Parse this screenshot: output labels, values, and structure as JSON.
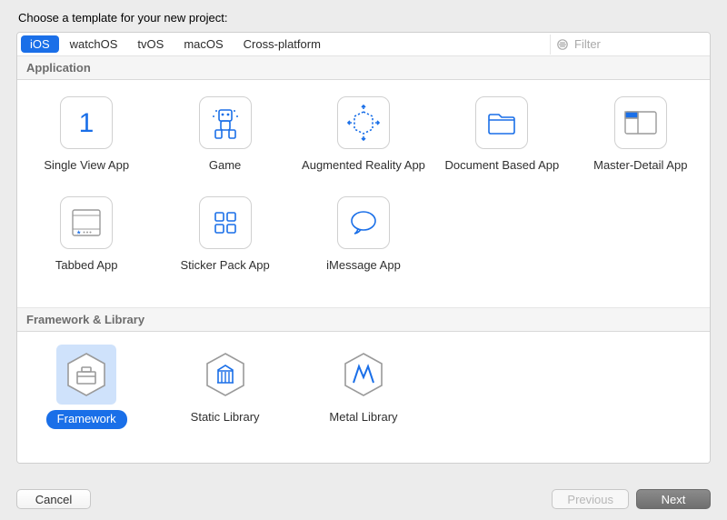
{
  "heading": "Choose a template for your new project:",
  "tabs": [
    "iOS",
    "watchOS",
    "tvOS",
    "macOS",
    "Cross-platform"
  ],
  "selected_tab_index": 0,
  "filter_placeholder": "Filter",
  "sections": {
    "application": {
      "title": "Application",
      "items": [
        {
          "id": "single-view-app",
          "label": "Single View App"
        },
        {
          "id": "game",
          "label": "Game"
        },
        {
          "id": "augmented-reality-app",
          "label": "Augmented Reality App"
        },
        {
          "id": "document-based-app",
          "label": "Document Based App"
        },
        {
          "id": "master-detail-app",
          "label": "Master-Detail App"
        },
        {
          "id": "tabbed-app",
          "label": "Tabbed App"
        },
        {
          "id": "sticker-pack-app",
          "label": "Sticker Pack App"
        },
        {
          "id": "imessage-app",
          "label": "iMessage App"
        }
      ]
    },
    "framework_library": {
      "title": "Framework & Library",
      "items": [
        {
          "id": "framework",
          "label": "Framework",
          "selected": true
        },
        {
          "id": "static-library",
          "label": "Static Library"
        },
        {
          "id": "metal-library",
          "label": "Metal Library"
        }
      ]
    }
  },
  "buttons": {
    "cancel": "Cancel",
    "previous": "Previous",
    "next": "Next"
  },
  "colors": {
    "accent": "#1a6fe8",
    "outline": "#9a9a9a"
  }
}
